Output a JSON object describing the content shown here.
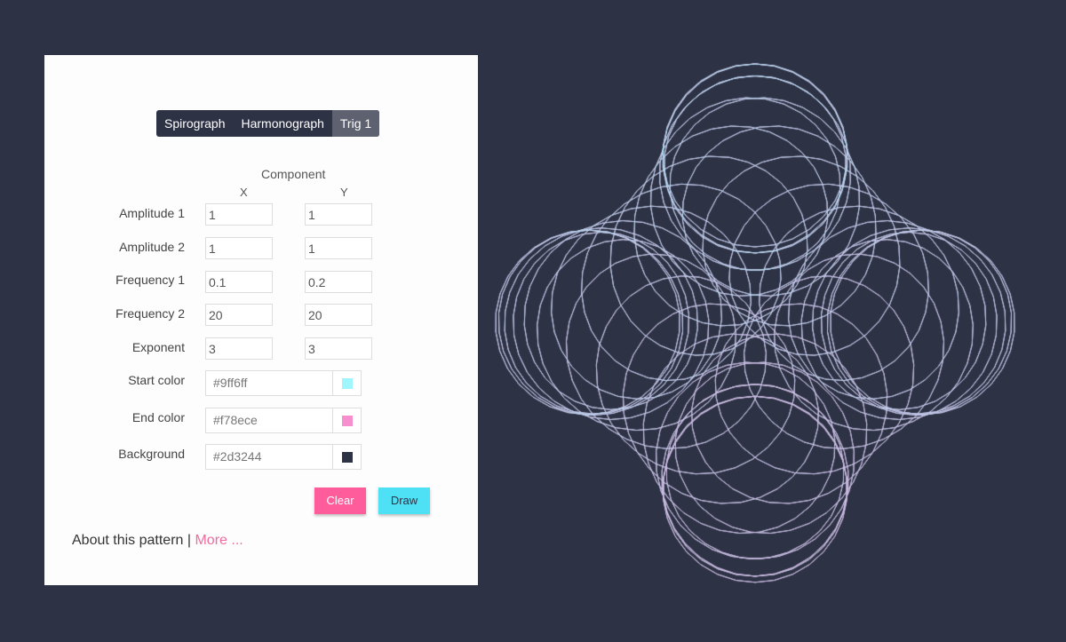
{
  "tabs": [
    {
      "label": "Spirograph"
    },
    {
      "label": "Harmonograph"
    },
    {
      "label": "Trig 1",
      "active": true
    }
  ],
  "form": {
    "component_label": "Component",
    "x_label": "X",
    "y_label": "Y",
    "rows": [
      {
        "label": "Amplitude 1",
        "x": "1",
        "y": "1"
      },
      {
        "label": "Amplitude 2",
        "x": "1",
        "y": "1"
      },
      {
        "label": "Frequency 1",
        "x": "0.1",
        "y": "0.2"
      },
      {
        "label": "Frequency 2",
        "x": "20",
        "y": "20"
      },
      {
        "label": "Exponent",
        "x": "3",
        "y": "3"
      }
    ],
    "colors": [
      {
        "label": "Start color",
        "value": "#9ff6ff"
      },
      {
        "label": "End color",
        "value": "#f78ece"
      },
      {
        "label": "Background",
        "value": "#2d3244"
      }
    ]
  },
  "buttons": {
    "clear": "Clear",
    "draw": "Draw",
    "clear_color": "#ff5c9b",
    "draw_color": "#4ee0f5"
  },
  "about": {
    "text": "About this pattern |",
    "link": "More ..."
  }
}
